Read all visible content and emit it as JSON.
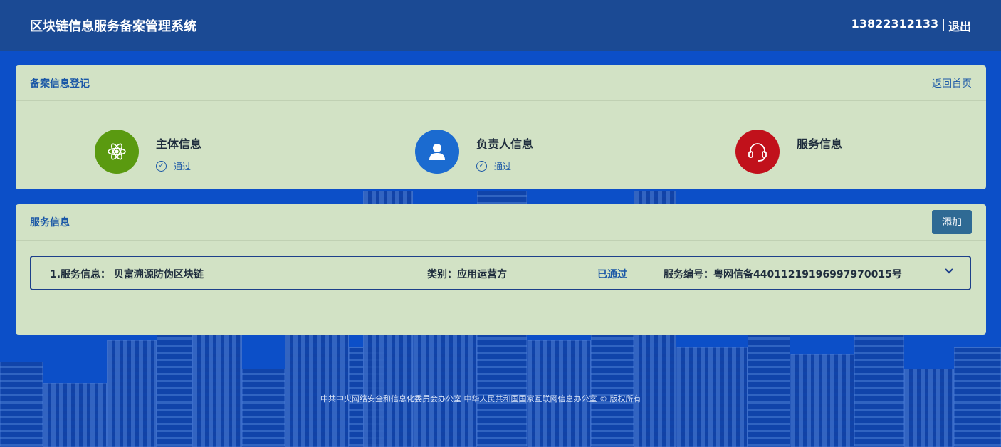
{
  "header": {
    "app_title": "区块链信息服务备案管理系统",
    "phone": "13822312133",
    "separator": "|",
    "logout": "退出"
  },
  "registration": {
    "title": "备案信息登记",
    "back_link": "返回首页",
    "steps": [
      {
        "name": "主体信息",
        "status": "通过",
        "icon": "atom-icon",
        "color": "#5a9a10"
      },
      {
        "name": "负责人信息",
        "status": "通过",
        "icon": "user-icon",
        "color": "#1b6bd0"
      },
      {
        "name": "服务信息",
        "status": "",
        "icon": "headset-icon",
        "color": "#c1111b"
      }
    ]
  },
  "services": {
    "title": "服务信息",
    "add_button": "添加",
    "rows": [
      {
        "name": "1.服务信息：  贝富溯源防伪区块链",
        "category": "类别：应用运营方",
        "status": "已通过",
        "number": "服务编号：粤网信备44011219196997970015号"
      }
    ]
  },
  "footer": {
    "text": "中共中央网络安全和信息化委员会办公室   中华人民共和国国家互联网信息办公室 © 版权所有"
  }
}
